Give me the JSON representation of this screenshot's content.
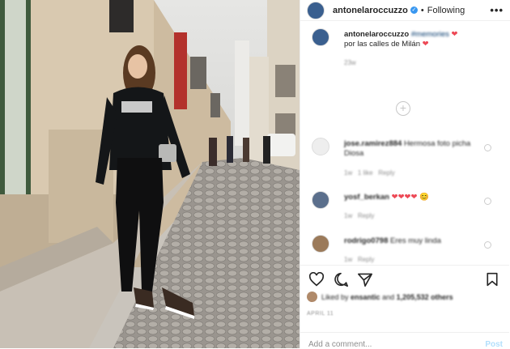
{
  "post": {
    "username": "antonelaroccuzzo",
    "follow_state": "Following",
    "separator": "•",
    "more_label": "•••",
    "verified_glyph": "✓",
    "avatar_initial": ""
  },
  "caption": {
    "username": "antonelaroccuzzo",
    "hashtag": "#memories",
    "text_line1_suffix": "❤",
    "text_line2": "por las calles de Milán",
    "text_line2_suffix": "❤",
    "age": "23w"
  },
  "comments": [
    {
      "username": "jose.ramirez884",
      "text": "Hermosa foto picha Diosa",
      "age": "1w",
      "likes": "1 like",
      "reply": "Reply"
    },
    {
      "username": "yosf_berkan",
      "text": "❤❤❤❤",
      "extra": "😊",
      "age": "1w",
      "reply": "Reply"
    },
    {
      "username": "rodrigo0798",
      "text": "Eres muy linda",
      "age": "1w",
      "reply": "Reply"
    }
  ],
  "actions": {
    "like_icon": "heart-icon",
    "comment_icon": "comment-icon",
    "share_icon": "share-icon",
    "save_icon": "bookmark-icon"
  },
  "likes": {
    "prefix": "Liked by",
    "user": "ensantic",
    "middle": "and",
    "count": "1,205,532 others"
  },
  "date": "APRIL 11",
  "add_comment": {
    "placeholder": "Add a comment...",
    "post_label": "Post"
  },
  "colors": {
    "verified": "#3897f0",
    "heart": "#ed4956",
    "post_disabled": "#b2dffc",
    "meta_gray": "#8e8e8e"
  }
}
